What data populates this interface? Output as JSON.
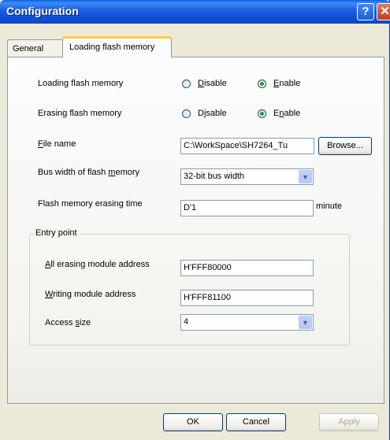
{
  "window": {
    "title": "Configuration"
  },
  "title_buttons": {
    "help": "?",
    "close": "✕"
  },
  "tabs": [
    {
      "label": "General",
      "active": false
    },
    {
      "label": "Loading flash memory",
      "active": true
    }
  ],
  "loading_flash": {
    "label": "Loading flash memory",
    "disable": "Disable",
    "enable": "Enable",
    "selected": "Enable"
  },
  "erasing_flash": {
    "label": "Erasing flash memory",
    "disable": "Disable",
    "enable": "Enable",
    "selected": "Enable"
  },
  "file_name": {
    "label": "File name",
    "value": "C:\\WorkSpace\\SH7264_Tu",
    "browse": "Browse..."
  },
  "bus_width": {
    "label": "Bus width of flash memory",
    "value": "32-bit bus width"
  },
  "erase_time": {
    "label": "Flash memory erasing time",
    "value": "D'1",
    "unit": "minute"
  },
  "entry_point": {
    "title": "Entry point",
    "all_erasing": {
      "label": "All erasing module address",
      "value": "H'FFF80000"
    },
    "writing": {
      "label": "Writing module address",
      "value": "H'FFF81100"
    },
    "access_size": {
      "label": "Access size",
      "value": "4"
    }
  },
  "footer": {
    "ok": "OK",
    "cancel": "Cancel",
    "apply": "Apply"
  },
  "colors": {
    "titlebar": "#0a5fe5",
    "face": "#ece9d8",
    "active_tab_accent": "#ffc83c"
  }
}
